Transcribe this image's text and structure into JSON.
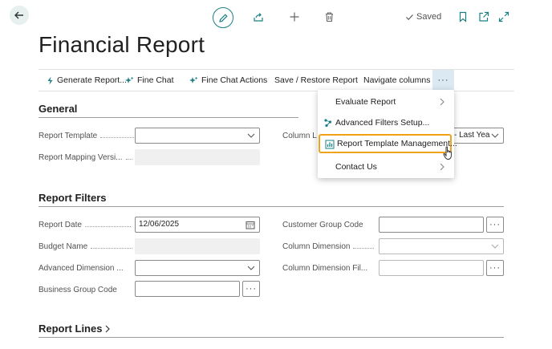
{
  "toolbar": {
    "saved_label": "Saved"
  },
  "page": {
    "title": "Financial Report"
  },
  "actions": [
    {
      "label": "Generate Report..."
    },
    {
      "label": "Fine Chat"
    },
    {
      "label": "Fine Chat Actions"
    },
    {
      "label": "Save / Restore Report"
    },
    {
      "label": "Navigate columns"
    }
  ],
  "more_label": "···",
  "menu": {
    "items": [
      {
        "label": "Evaluate Report"
      },
      {
        "label": "Advanced Filters Setup..."
      },
      {
        "label": "Report Template Management..."
      },
      {
        "label": "Contact Us"
      }
    ]
  },
  "general": {
    "title": "General",
    "report_template_label": "Report Template",
    "report_template_value": "",
    "report_mapping_label": "Report Mapping Versi...",
    "report_mapping_value": "",
    "column_layout_label": "Column L",
    "column_layout_value": "- Last Yea"
  },
  "filters": {
    "title": "Report Filters",
    "report_date_label": "Report Date",
    "report_date_value": "12/06/2025",
    "budget_name_label": "Budget Name",
    "budget_name_value": "",
    "adv_dimension_label": "Advanced Dimension ...",
    "adv_dimension_value": "",
    "business_group_label": "Business Group Code",
    "business_group_value": "",
    "customer_group_label": "Customer Group Code",
    "customer_group_value": "",
    "column_dimension_label": "Column Dimension",
    "column_dimension_value": "",
    "column_dimension_filter_label": "Column Dimension Fil...",
    "column_dimension_filter_value": "",
    "ellipsis": "···"
  },
  "report_lines": {
    "title": "Report Lines"
  },
  "colors": {
    "accent": "#1a7f84",
    "highlight": "#f1a21b",
    "more_bg": "#dbe9f3"
  }
}
